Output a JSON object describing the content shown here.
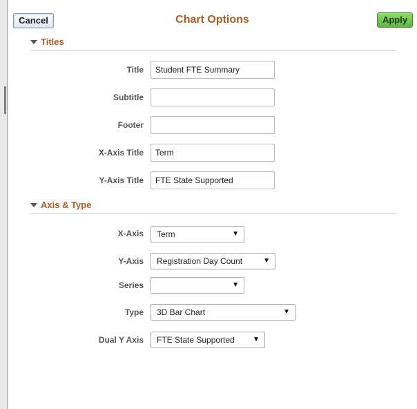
{
  "header": {
    "title": "Chart Options",
    "cancel_label": "Cancel",
    "apply_label": "Apply"
  },
  "titles_section": {
    "heading": "Titles",
    "fields": [
      {
        "label": "Title",
        "value": "Student FTE Summary"
      },
      {
        "label": "Subtitle",
        "value": ""
      },
      {
        "label": "Footer",
        "value": ""
      },
      {
        "label": "X-Axis Title",
        "value": "Term"
      },
      {
        "label": "Y-Axis Title",
        "value": "FTE State Supported"
      }
    ]
  },
  "axis_section": {
    "heading": "Axis & Type",
    "fields": [
      {
        "label": "X-Axis",
        "value": "Term"
      },
      {
        "label": "Y-Axis",
        "value": "Registration Day Count"
      },
      {
        "label": "Series",
        "value": ""
      },
      {
        "label": "Type",
        "value": "3D Bar Chart"
      },
      {
        "label": "Dual Y Axis",
        "value": "FTE State Supported"
      }
    ]
  },
  "icons": {
    "expand": "triangle-down-icon",
    "dropdown": "dropdown-arrow-icon"
  },
  "colors": {
    "heading": "#b35a1f",
    "apply_button": "#5fb540",
    "cancel_border": "#7b9bc8"
  }
}
